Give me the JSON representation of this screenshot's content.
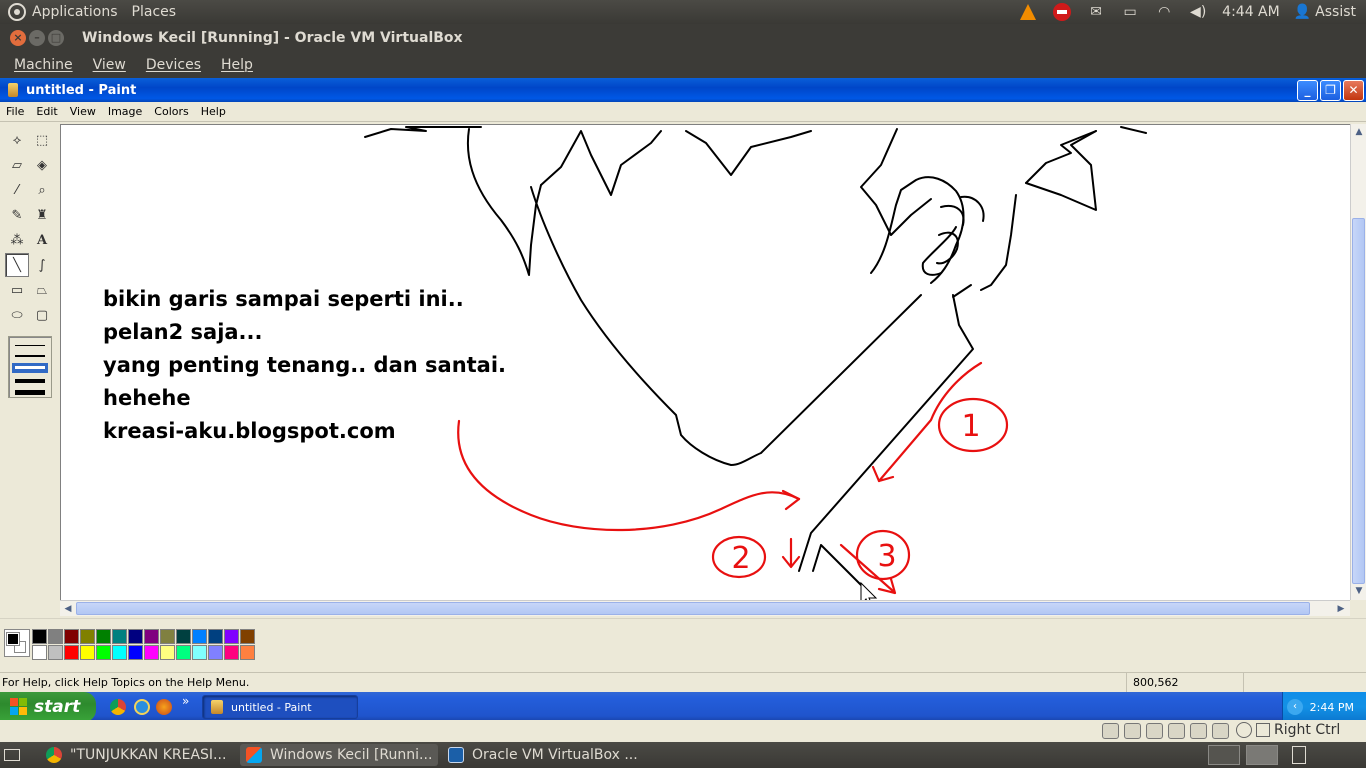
{
  "ubuntu_panel": {
    "menus": [
      "Applications",
      "Places"
    ],
    "clock": "4:44 AM",
    "user": "Assist",
    "tray_icons": [
      "vlc-icon",
      "stop-icon",
      "mail-icon",
      "battery-icon",
      "wifi-icon",
      "volume-icon"
    ]
  },
  "vbox": {
    "title": "Windows Kecil [Running] - Oracle VM VirtualBox",
    "menus": [
      "Machine",
      "View",
      "Devices",
      "Help"
    ],
    "host_key": "Right Ctrl"
  },
  "paint": {
    "title": "untitled - Paint",
    "menus": [
      "File",
      "Edit",
      "View",
      "Image",
      "Colors",
      "Help"
    ],
    "canvas_lines": [
      "bikin garis sampai seperti ini..",
      "pelan2 saja...",
      "yang penting tenang.. dan santai.",
      "hehehe",
      "kreasi-aku.blogspot.com"
    ],
    "status_help": "For Help, click Help Topics on the Help Menu.",
    "status_coords": "800,562",
    "palette_top": [
      "#000000",
      "#808080",
      "#800000",
      "#808000",
      "#008000",
      "#008080",
      "#000080",
      "#800080",
      "#808040",
      "#004040",
      "#0080ff",
      "#004080",
      "#8000ff",
      "#804000"
    ],
    "palette_bottom": [
      "#ffffff",
      "#c0c0c0",
      "#ff0000",
      "#ffff00",
      "#00ff00",
      "#00ffff",
      "#0000ff",
      "#ff00ff",
      "#ffff80",
      "#00ff80",
      "#80ffff",
      "#8080ff",
      "#ff0080",
      "#ff8040"
    ],
    "annotation_labels": [
      "1",
      "2",
      "3"
    ],
    "annotation_color": "#e81010"
  },
  "xp_taskbar": {
    "start_label": "start",
    "task": "untitled - Paint",
    "clock": "2:44 PM"
  },
  "ubuntu_bottom": {
    "tasks": [
      "\"TUNJUKKAN KREASI...",
      "Windows Kecil [Runni...",
      "Oracle VM VirtualBox ..."
    ]
  }
}
